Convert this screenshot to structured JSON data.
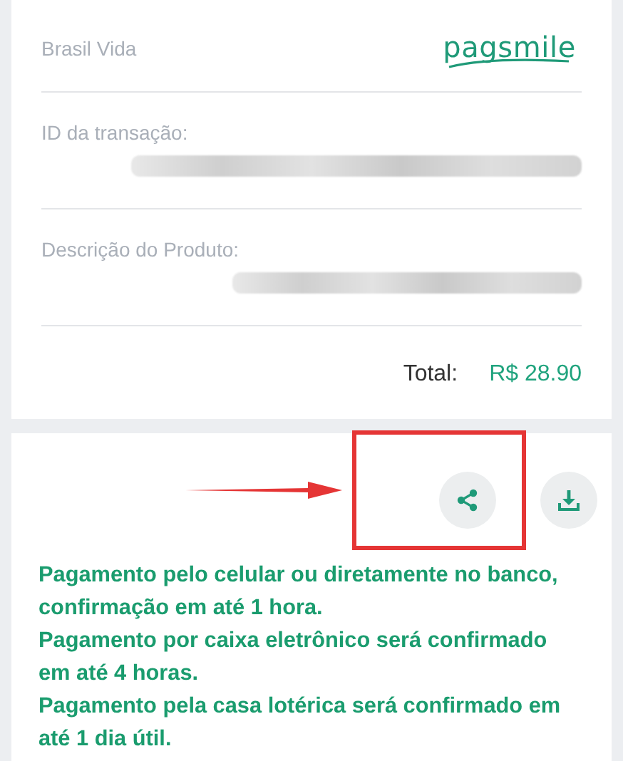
{
  "merchant": {
    "name": "Brasil Vida",
    "logo_text": "pagsmile"
  },
  "fields": [
    {
      "label": "ID da transação:",
      "redacted": true
    },
    {
      "label": "Descrição do Produto:",
      "redacted": true
    }
  ],
  "total": {
    "label": "Total:",
    "amount": "R$ 28.90"
  },
  "actions": [
    {
      "kind": "share"
    },
    {
      "kind": "download"
    }
  ],
  "annotation": {
    "arrow": true,
    "highlight_box": true
  },
  "notes": [
    "Pagamento pelo celular ou diretamente no banco, confirmação em até 1 hora.",
    "Pagamento por caixa eletrônico será confirmado em até 4 horas.",
    "Pagamento pela casa lotérica será confirmado em até 1 dia útil."
  ]
}
